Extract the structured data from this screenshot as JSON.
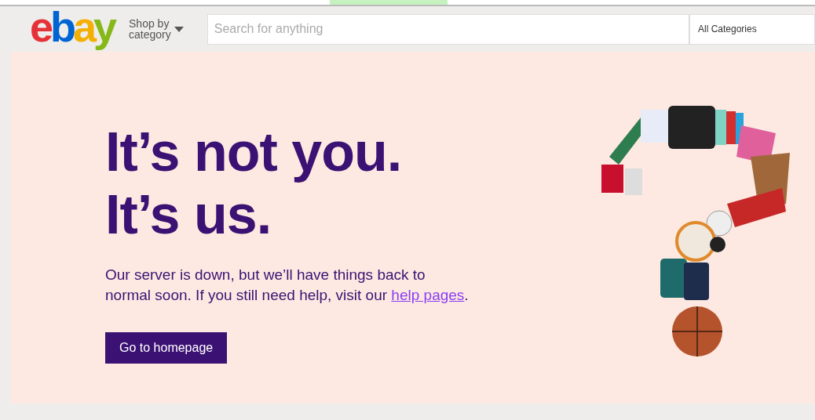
{
  "header": {
    "logo": [
      {
        "char": "e",
        "color": "#e53238"
      },
      {
        "char": "b",
        "color": "#0064d2"
      },
      {
        "char": "a",
        "color": "#f5af02"
      },
      {
        "char": "y",
        "color": "#86b817"
      }
    ],
    "shop_by_category": {
      "lines": [
        "Shop by",
        "category"
      ]
    },
    "search": {
      "placeholder": "Search for anything"
    },
    "category_select": {
      "value": "All Categories"
    }
  },
  "error": {
    "headline": [
      "It’s not you.",
      "It’s us."
    ],
    "message": "Our server is down, but we’ll have things back to normal soon. If you still need help, visit our ",
    "link": "help pages",
    "after_link": ".",
    "button": "Go to homepage"
  }
}
